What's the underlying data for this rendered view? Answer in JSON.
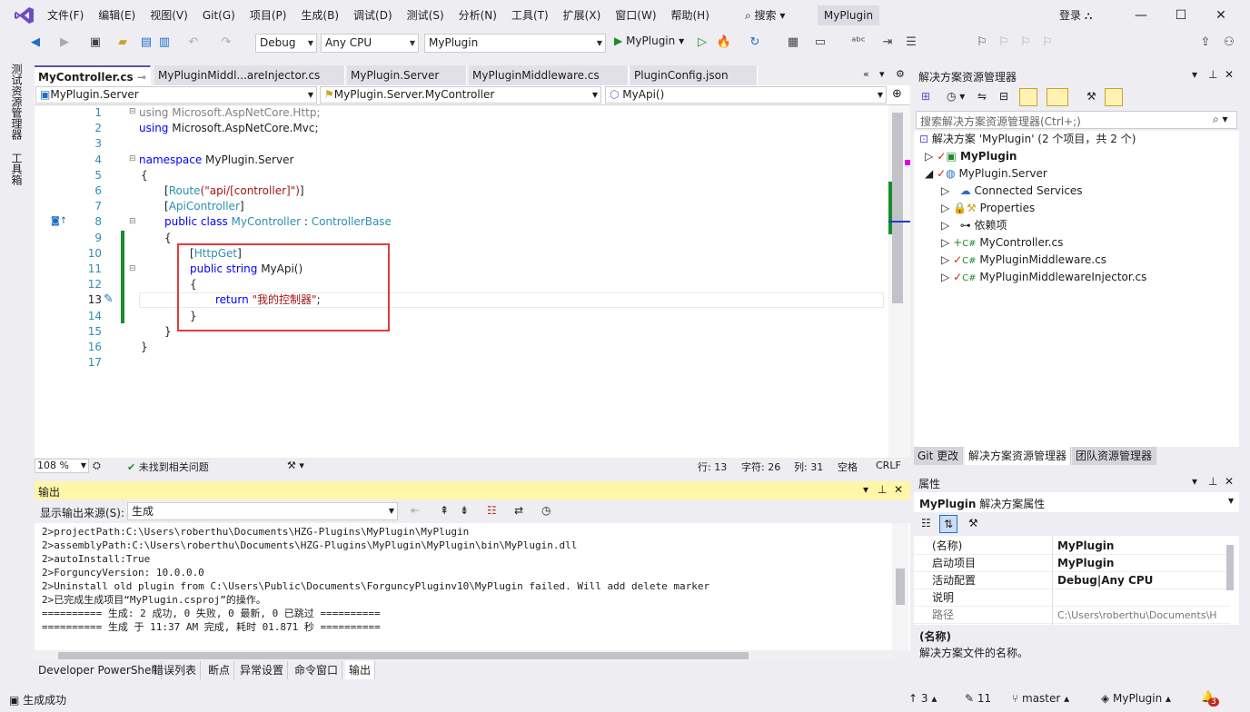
{
  "menu": [
    "文件(F)",
    "编辑(E)",
    "视图(V)",
    "Git(G)",
    "项目(P)",
    "生成(B)",
    "调试(D)",
    "测试(S)",
    "分析(N)",
    "工具(T)",
    "扩展(X)",
    "窗口(W)",
    "帮助(H)"
  ],
  "search": "搜索",
  "project_name": "MyPlugin",
  "login": "登录",
  "toolbar": {
    "config": "Debug",
    "platform": "Any CPU",
    "startup": "MyPlugin",
    "run_label": "MyPlugin"
  },
  "left_strip": [
    "测试资源管理器",
    "工具箱"
  ],
  "editor_tabs": [
    {
      "label": "MyController.cs"
    },
    {
      "label": "MyPluginMiddl...areInjector.cs"
    },
    {
      "label": "MyPlugin.Server"
    },
    {
      "label": "MyPluginMiddleware.cs"
    },
    {
      "label": "PluginConfig.json"
    }
  ],
  "nav": {
    "project": "MyPlugin.Server",
    "class": "MyPlugin.Server.MyController",
    "member": "MyApi()"
  },
  "line_numbers": [
    "1",
    "2",
    "3",
    "4",
    "5",
    "6",
    "7",
    "8",
    "9",
    "10",
    "11",
    "12",
    "13",
    "14",
    "15",
    "16",
    "17"
  ],
  "code": {
    "l1a": "using",
    "l1b": " Microsoft.AspNetCore.Http;",
    "l2a": "using",
    "l2b": " Microsoft.AspNetCore.Mvc;",
    "l4a": "namespace",
    "l4b": " MyPlugin.Server",
    "l5": "{",
    "l6a": "[",
    "l6b": "Route",
    "l6c": "(\"api/[controller]\")",
    "l6d": "]",
    "l7a": "[",
    "l7b": "ApiController",
    "l7c": "]",
    "l8a": "public class ",
    "l8b": "MyController",
    "l8c": " : ",
    "l8d": "ControllerBase",
    "l9": "{",
    "l10a": "[",
    "l10b": "HttpGet",
    "l10c": "]",
    "l11a": "public string ",
    "l11b": "MyApi()",
    "l12": "{",
    "l13a": "return ",
    "l13b": "\"我的控制器\"",
    "l13c": ";",
    "l14": "}",
    "l15": "}",
    "l16": "}"
  },
  "editor_status": {
    "zoom": "108 %",
    "issues": "未找到相关问题",
    "line": "行: 13",
    "char": "字符: 26",
    "col": "列: 31",
    "ws": "空格",
    "eol": "CRLF"
  },
  "output": {
    "title": "输出",
    "source_label": "显示输出来源(S):",
    "source_value": "生成",
    "lines": [
      "2>projectPath:C:\\Users\\roberthu\\Documents\\HZG-Plugins\\MyPlugin\\MyPlugin",
      "2>assemblyPath:C:\\Users\\roberthu\\Documents\\HZG-Plugins\\MyPlugin\\MyPlugin\\bin\\MyPlugin.dll",
      "2>autoInstall:True",
      "2>ForguncyVersion: 10.0.0.0",
      "2>Uninstall old plugin from C:\\Users\\Public\\Documents\\ForguncyPluginv10\\MyPlugin failed. Will add delete marker",
      "2>已完成生成项目“MyPlugin.csproj”的操作。",
      "========== 生成: 2 成功, 0 失败, 0 最新, 0 已跳过 ==========",
      "========== 生成 于 11:37 AM 完成, 耗时 01.871 秒 =========="
    ]
  },
  "bottom_tabs": [
    "Developer PowerShell",
    "错误列表",
    "断点",
    "异常设置",
    "命令窗口",
    "输出"
  ],
  "solution_explorer": {
    "title": "解决方案资源管理器",
    "search_placeholder": "搜索解决方案资源管理器(Ctrl+;)",
    "solution": "解决方案 'MyPlugin' (2 个项目，共 2 个)",
    "items": [
      "MyPlugin",
      "MyPlugin.Server",
      "Connected Services",
      "Properties",
      "依赖项",
      "MyController.cs",
      "MyPluginMiddleware.cs",
      "MyPluginMiddlewareInjector.cs"
    ],
    "tabs": [
      "Git 更改",
      "解决方案资源管理器",
      "团队资源管理器"
    ]
  },
  "properties": {
    "title": "属性",
    "object": "MyPlugin",
    "object_type": "解决方案属性",
    "rows": [
      {
        "k": "(名称)",
        "v": "MyPlugin"
      },
      {
        "k": "启动项目",
        "v": "MyPlugin"
      },
      {
        "k": "活动配置",
        "v": "Debug|Any CPU"
      },
      {
        "k": "说明",
        "v": ""
      },
      {
        "k": "路径",
        "v": "C:\\Users\\roberthu\\Documents\\H"
      }
    ],
    "desc_title": "(名称)",
    "desc_text": "解决方案文件的名称。"
  },
  "statusbar": {
    "message": "生成成功",
    "up": "3",
    "edits": "11",
    "branch": "master",
    "repo": "MyPlugin",
    "notif": "3"
  }
}
